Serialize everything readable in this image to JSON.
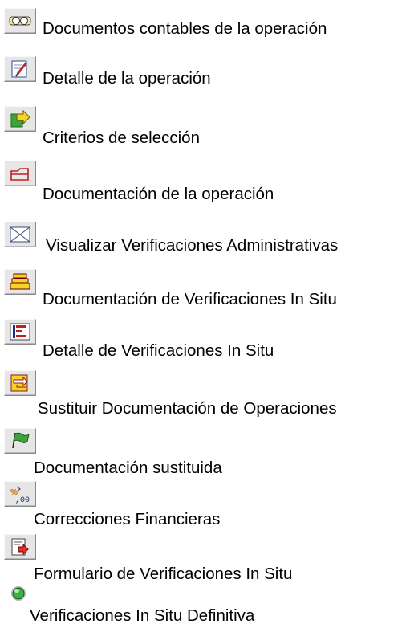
{
  "items": [
    {
      "icon": "view-accounting-icon",
      "label": "Documentos contables de la operación"
    },
    {
      "icon": "edit-detail-icon",
      "label": "Detalle de la operación"
    },
    {
      "icon": "selection-arrow-icon",
      "label": "Criterios de selección"
    },
    {
      "icon": "folder-icon",
      "label": "Documentación de la operación"
    },
    {
      "icon": "envelope-icon",
      "label": "Visualizar Verificaciones Administrativas"
    },
    {
      "icon": "stacked-documents-icon",
      "label": "Documentación de Verificaciones In Situ"
    },
    {
      "icon": "list-detail-icon",
      "label": "Detalle de Verificaciones In Situ"
    },
    {
      "icon": "replace-documents-icon",
      "label": "Sustituir Documentación de Operaciones"
    },
    {
      "icon": "green-flag-icon",
      "label": "Documentación sustituida"
    },
    {
      "icon": "financial-correction-icon",
      "label": "Correcciones Financieras"
    },
    {
      "icon": "form-arrow-icon",
      "label": "Formulario de Verificaciones In Situ"
    },
    {
      "icon": "green-status-light-icon",
      "label": "Verificaciones In Situ Definitiva"
    }
  ]
}
